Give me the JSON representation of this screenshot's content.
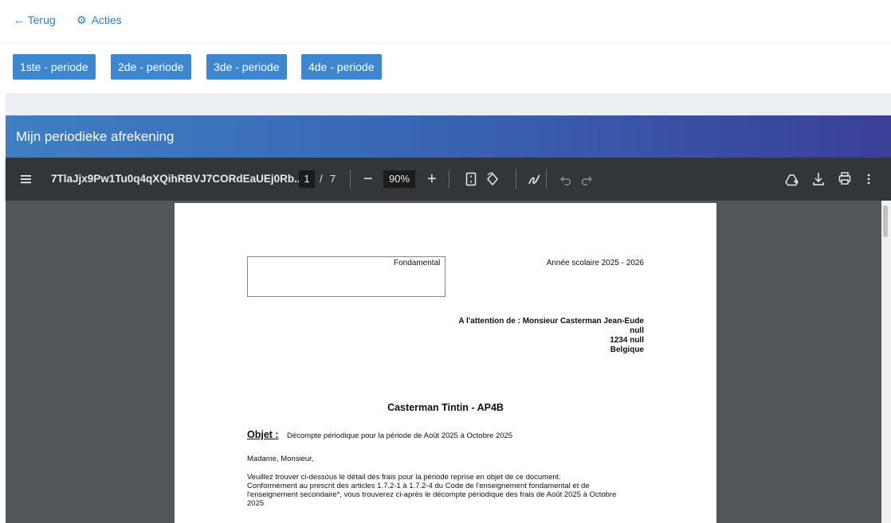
{
  "topnav": {
    "back_label": "← Terug",
    "actions_icon": "⚙",
    "actions_label": "Acties"
  },
  "periods": [
    "1ste - periode",
    "2de - periode",
    "3de - periode",
    "4de - periode"
  ],
  "panel": {
    "title": "Mijn periodieke afrekening"
  },
  "pdf": {
    "filename": "7TlaJjx9Pw1Tu0q4qXQihRBVJ7CORdEaUEj0Rb...",
    "current_page": "1",
    "page_sep": "/",
    "total_pages": "7",
    "zoom": "90%",
    "zoom_out": "−",
    "zoom_in": "+"
  },
  "document": {
    "box_label": "Fondamental",
    "school_year": "Année scolaire 2025 - 2026",
    "attention": "A l'attention de : Monsieur Casterman Jean-Eude",
    "addr_line1": "null",
    "addr_line2": "1234 null",
    "addr_line3": "Belgique",
    "student": "Casterman Tintin - AP4B",
    "objet_label": "Objet :",
    "objet_text": "Décompte périodique pour la période de Août 2025 à Octobre 2025",
    "salutation": "Madame, Monsieur,",
    "body_line1": "Veuillez trouver ci-dessous le détail des frais pour la période reprise en objet de ce document.",
    "body_line2": "Conformément au prescrit des articles 1.7.2-1 à 1.7.2-4 du Code de l'enseignement fondamental et de",
    "body_line3": "l'enseignement secondaire*, vous trouverez ci-après le décompte périodique des frais de Août 2025 à Octobre",
    "body_line4": "2025"
  }
}
